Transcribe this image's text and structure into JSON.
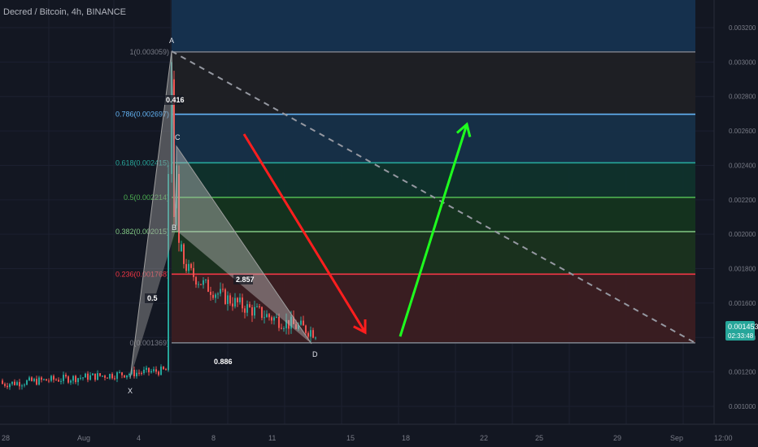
{
  "header": {
    "symbol_title": "Decred / Bitcoin, 4h, BINANCE"
  },
  "axis_unit": "BTC",
  "price_scale": {
    "ticks": [
      "0.003200",
      "0.003000",
      "0.002800",
      "0.002600",
      "0.002400",
      "0.002200",
      "0.002000",
      "0.001800",
      "0.001600",
      "0.001400",
      "0.001200",
      "0.001000"
    ],
    "last_price": "0.001453",
    "countdown": "02:33:48"
  },
  "time_scale": {
    "ticks": [
      "28",
      "Aug",
      "4",
      "8",
      "11",
      "15",
      "18",
      "22",
      "25",
      "29",
      "Sep",
      "12:00"
    ]
  },
  "fib_levels": [
    {
      "label": "1(0.003059)",
      "color": "#787b86"
    },
    {
      "label": "0.786(0.002697)",
      "color": "#64b5f6"
    },
    {
      "label": "0.618(0.002415)",
      "color": "#26a69a"
    },
    {
      "label": "0.5(0.002214)",
      "color": "#4caf50"
    },
    {
      "label": "0.382(0.002015)",
      "color": "#81c784"
    },
    {
      "label": "0.236(0.001768)",
      "color": "#f23645"
    },
    {
      "label": "0(0.001369)",
      "color": "#787b86"
    }
  ],
  "pattern": {
    "points": [
      "X",
      "A",
      "B",
      "C",
      "D"
    ],
    "ratios": [
      "0.5",
      "0.416",
      "2.857",
      "0.886"
    ]
  },
  "colors": {
    "bull": "#26a69a",
    "bear": "#ef5350",
    "red_arrow": "#ff1e1e",
    "green_arrow": "#1eff1e",
    "price_badge": "#26a69a"
  },
  "chart_data": {
    "type": "candlestick",
    "title": "Decred / Bitcoin, 4h, BINANCE",
    "ylabel": "BTC",
    "ylim": [
      0.00092,
      0.00335
    ],
    "x_ticks": [
      "28",
      "Aug",
      "4",
      "8",
      "11",
      "15",
      "18",
      "22",
      "25",
      "29",
      "Sep",
      "12:00"
    ],
    "fib_retracement": [
      {
        "ratio": 1,
        "price": 0.003059
      },
      {
        "ratio": 0.786,
        "price": 0.002697
      },
      {
        "ratio": 0.618,
        "price": 0.002415
      },
      {
        "ratio": 0.5,
        "price": 0.002214
      },
      {
        "ratio": 0.382,
        "price": 0.002015
      },
      {
        "ratio": 0.236,
        "price": 0.001768
      },
      {
        "ratio": 0,
        "price": 0.001369
      }
    ],
    "last_price": 0.001453,
    "pattern_points": {
      "X": {
        "date": "Aug 4",
        "price": 0.00118
      },
      "A": {
        "date": "Aug 5",
        "price": 0.003059
      },
      "B": {
        "date": "Aug 5",
        "price": 0.00205
      },
      "C": {
        "date": "Aug 5",
        "price": 0.00251
      },
      "D": {
        "date": "Aug 12",
        "price": 0.001369
      }
    },
    "price_path": [
      {
        "date": "Jul 28",
        "price": 0.00113
      },
      {
        "date": "Jul 29",
        "price": 0.00116
      },
      {
        "date": "Jul 30",
        "price": 0.0012
      },
      {
        "date": "Jul 31",
        "price": 0.00118
      },
      {
        "date": "Aug 1",
        "price": 0.00117
      },
      {
        "date": "Aug 2",
        "price": 0.00119
      },
      {
        "date": "Aug 3",
        "price": 0.00117
      },
      {
        "date": "Aug 4",
        "price": 0.00119
      },
      {
        "date": "Aug 5",
        "price": 0.00123
      },
      {
        "date": "Aug 5",
        "price": 0.003
      },
      {
        "date": "Aug 6",
        "price": 0.0019
      },
      {
        "date": "Aug 7",
        "price": 0.00175
      },
      {
        "date": "Aug 8",
        "price": 0.00158
      },
      {
        "date": "Aug 9",
        "price": 0.0015
      },
      {
        "date": "Aug 10",
        "price": 0.00147
      },
      {
        "date": "Aug 11",
        "price": 0.00144
      },
      {
        "date": "Aug 12",
        "price": 0.00142
      },
      {
        "date": "Aug 13",
        "price": 0.001453
      }
    ]
  }
}
